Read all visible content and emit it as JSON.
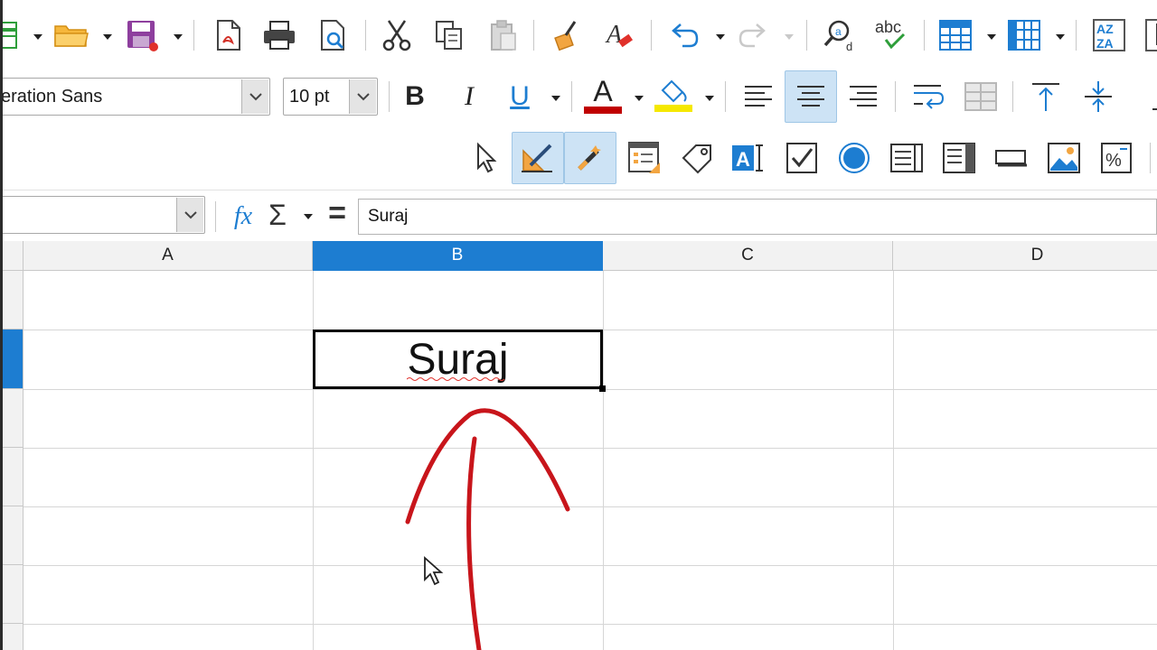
{
  "toolbar": {
    "font_name": "Liberation Sans",
    "font_name_visible": "eration Sans",
    "font_size": "10 pt",
    "bold_label": "B",
    "italic_label": "I",
    "underline_label": "U",
    "font_color_label": "A",
    "spelling_label": "abc",
    "sort_label_top": "AZ",
    "sort_label_bottom": "ZA"
  },
  "formula_bar": {
    "function_wizard_label": "fx",
    "sum_label": "Σ",
    "equals_label": "=",
    "content": "Suraj"
  },
  "columns": [
    {
      "label": "A"
    },
    {
      "label": "B"
    },
    {
      "label": "C"
    },
    {
      "label": "D"
    }
  ],
  "active_cell": {
    "column": "B",
    "value": "Suraj"
  },
  "colors": {
    "accent": "#1d7dd1",
    "highlight": "#cde3f5",
    "annotation": "#c8151b",
    "font_color_bar": "#c00000",
    "highlight_bar": "#f5e800"
  }
}
